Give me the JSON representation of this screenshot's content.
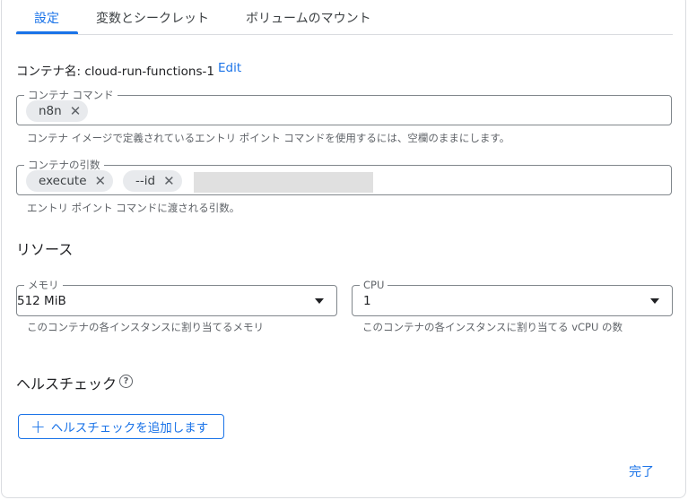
{
  "tabs": [
    {
      "label": "設定",
      "active": true
    },
    {
      "label": "変数とシークレット",
      "active": false
    },
    {
      "label": "ボリュームのマウント",
      "active": false
    }
  ],
  "container": {
    "name_label": "コンテナ名: cloud-run-functions-1",
    "edit_label": "Edit"
  },
  "command": {
    "label": "コンテナ コマンド",
    "chips": [
      "n8n"
    ],
    "helper": "コンテナ イメージで定義されているエントリ ポイント コマンドを使用するには、空欄のままにします。"
  },
  "args": {
    "label": "コンテナの引数",
    "chips": [
      "execute",
      "--id"
    ],
    "helper": "エントリ ポイント コマンドに渡される引数。"
  },
  "resources": {
    "title": "リソース",
    "memory": {
      "label": "メモリ",
      "value": "512 MiB",
      "helper": "このコンテナの各インスタンスに割り当てるメモリ"
    },
    "cpu": {
      "label": "CPU",
      "value": "1",
      "helper": "このコンテナの各インスタンスに割り当てる vCPU の数"
    }
  },
  "health": {
    "title": "ヘルスチェック",
    "add_label": "ヘルスチェックを追加します"
  },
  "done_label": "完了",
  "colors": {
    "accent": "#1a73e8",
    "chip_bg": "#e8eaed",
    "border": "#80868b"
  }
}
